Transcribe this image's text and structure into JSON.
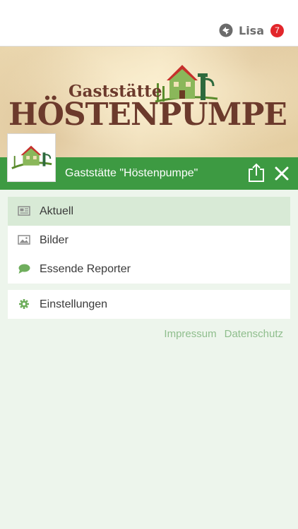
{
  "header": {
    "user_name": "Lisa",
    "notification_count": "7"
  },
  "banner": {
    "subtitle": "Gaststätte",
    "title": "HÖSTENPUMPE"
  },
  "titlebar": {
    "title": "Gaststätte \"Höstenpumpe\""
  },
  "menu": {
    "items": [
      {
        "label": "Aktuell",
        "icon": "newspaper-icon",
        "active": true
      },
      {
        "label": "Bilder",
        "icon": "image-icon",
        "active": false
      },
      {
        "label": "Essende Reporter",
        "icon": "chat-bubble-icon",
        "active": false
      }
    ],
    "settings": {
      "label": "Einstellungen",
      "icon": "gear-icon"
    }
  },
  "footer": {
    "impressum": "Impressum",
    "datenschutz": "Datenschutz"
  },
  "colors": {
    "primary_green": "#3d9a42",
    "active_bg": "#d8ead6",
    "page_bg": "#edf5ec",
    "badge_red": "#e2262b",
    "link_green": "#8fbe8d"
  }
}
